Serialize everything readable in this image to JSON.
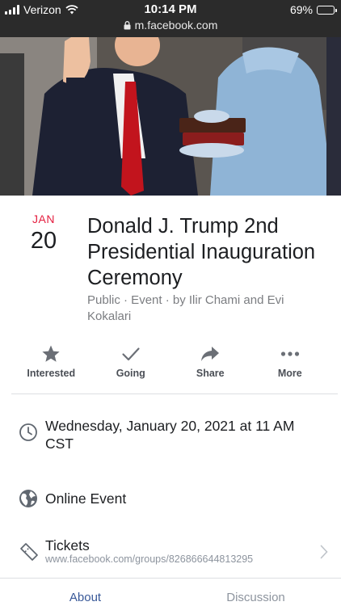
{
  "status_bar": {
    "carrier": "Verizon",
    "time": "10:14 PM",
    "battery": "69%",
    "battery_level": 0.69,
    "url": "m.facebook.com"
  },
  "event": {
    "month": "JAN",
    "day": "20",
    "title": "Donald J. Trump 2nd Presidential Inauguration Ceremony",
    "meta": "Public · Event · by Ilir Chami and Evi Kokalari"
  },
  "actions": [
    {
      "label": "Interested",
      "icon": "star-icon"
    },
    {
      "label": "Going",
      "icon": "checkmark-icon"
    },
    {
      "label": "Share",
      "icon": "share-arrow-icon"
    },
    {
      "label": "More",
      "icon": "more-dots-icon"
    }
  ],
  "details": {
    "datetime": "Wednesday, January 20, 2021 at 11 AM CST",
    "location": "Online Event",
    "tickets_label": "Tickets",
    "tickets_url": "www.facebook.com/groups/826866644813295"
  },
  "tabs": [
    {
      "label": "About",
      "active": true
    },
    {
      "label": "Discussion",
      "active": false
    }
  ],
  "colors": {
    "accent": "#385898",
    "date_red": "#e41e3f",
    "status_bar": "#2b2b2b"
  }
}
